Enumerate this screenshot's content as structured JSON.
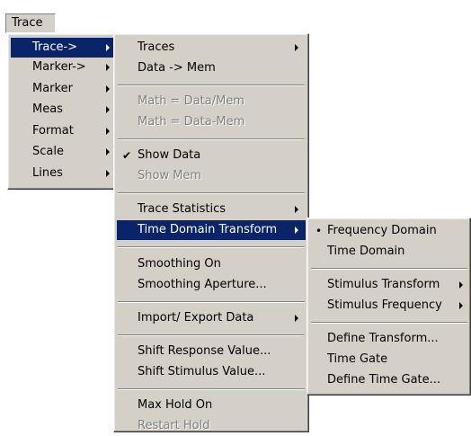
{
  "menubar": {
    "trace_label": "Trace"
  },
  "menu1": {
    "items": [
      {
        "label": "Trace->"
      },
      {
        "label": "Marker->"
      },
      {
        "label": "Marker"
      },
      {
        "label": "Meas"
      },
      {
        "label": "Format"
      },
      {
        "label": "Scale"
      },
      {
        "label": "Lines"
      }
    ]
  },
  "menu2": {
    "items": [
      {
        "label": "Traces"
      },
      {
        "label": "Data -> Mem"
      },
      {
        "label": "Math = Data/Mem"
      },
      {
        "label": "Math = Data-Mem"
      },
      {
        "label": "Show Data",
        "check": "✔"
      },
      {
        "label": "Show Mem"
      },
      {
        "label": "Trace Statistics"
      },
      {
        "label": "Time Domain Transform"
      },
      {
        "label": "Smoothing On"
      },
      {
        "label": "Smoothing Aperture..."
      },
      {
        "label": "Import/ Export Data"
      },
      {
        "label": "Shift Response Value..."
      },
      {
        "label": "Shift Stimulus Value..."
      },
      {
        "label": "Max Hold On"
      },
      {
        "label": "Restart Hold"
      }
    ]
  },
  "menu3": {
    "items": [
      {
        "label": "Frequency Domain",
        "bullet": "•"
      },
      {
        "label": "Time Domain"
      },
      {
        "label": "Stimulus Transform"
      },
      {
        "label": "Stimulus Frequency"
      },
      {
        "label": "Define Transform..."
      },
      {
        "label": "Time Gate"
      },
      {
        "label": "Define Time Gate..."
      }
    ]
  }
}
